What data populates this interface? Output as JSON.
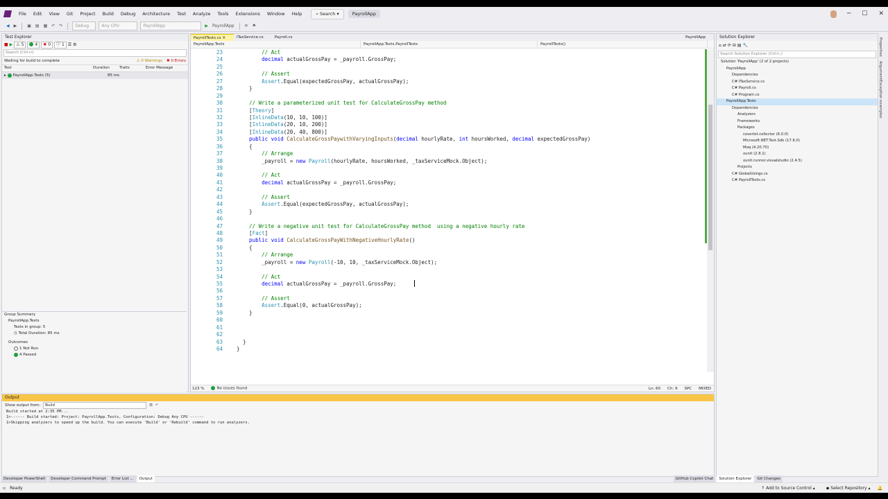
{
  "menubar": {
    "items": [
      "File",
      "Edit",
      "View",
      "Git",
      "Project",
      "Build",
      "Debug",
      "Architecture",
      "Test",
      "Analyze",
      "Tools",
      "Extensions",
      "Window",
      "Help"
    ],
    "search": "Search",
    "app_title": "PayrollApp"
  },
  "toolbar": {
    "config": "Debug",
    "platform": "Any CPU",
    "project": "PayrollApp",
    "run_target": "PayrollApp"
  },
  "test_explorer": {
    "title": "Test Explorer",
    "counts": {
      "warn": "5",
      "passed": "4",
      "failed": "0",
      "not_run": "1"
    },
    "search_placeholder": "Search (Ctrl+I)",
    "status": "Waiting for build to complete",
    "warnings": "0 Warnings",
    "errors": "0 Errors",
    "columns": {
      "test": "Test",
      "duration": "Duration",
      "traits": "Traits",
      "error": "Error Message"
    },
    "row": {
      "name": "PayrollApp.Tests (5)",
      "duration": "85 ms"
    },
    "summary": {
      "title": "Group Summary",
      "project": "PayrollApp.Tests",
      "tests_in_group": "Tests in group: 5",
      "total_duration": "Total Duration: 85 ms",
      "outcomes": "Outcomes",
      "not_run": "1 Not Run",
      "passed": "4 Passed"
    }
  },
  "editor": {
    "tabs": [
      "PayrollTests.cs",
      "ITaxService.cs",
      "Payroll.cs"
    ],
    "right_tab": "PayrollApp",
    "nav": [
      "PayrollApp.Tests",
      "PayrollApp.Tests.PayrollTests",
      "PayrollTests()"
    ],
    "status": {
      "zoom": "123 %",
      "issues": "No issues found",
      "ln": "Ln: 60",
      "ch": "Ch: 9",
      "spc": "SPC",
      "mixed": "MIXED"
    }
  },
  "code_lines": [
    {
      "n": "23",
      "t": [
        [
          "c",
          "        // Act"
        ]
      ]
    },
    {
      "n": "24",
      "t": [
        [
          "",
          "        "
        ],
        [
          "k",
          "decimal"
        ],
        [
          "",
          " actualGrossPay = _payroll.GrossPay;"
        ]
      ]
    },
    {
      "n": "25",
      "t": []
    },
    {
      "n": "26",
      "t": [
        [
          "c",
          "        // Assert"
        ]
      ]
    },
    {
      "n": "27",
      "t": [
        [
          "",
          "        "
        ],
        [
          "t",
          "Assert"
        ],
        [
          "",
          ".Equal(expectedGrossPay, actualGrossPay);"
        ]
      ]
    },
    {
      "n": "28",
      "t": [
        [
          "",
          "    }"
        ]
      ]
    },
    {
      "n": "29",
      "t": []
    },
    {
      "n": "30",
      "t": [
        [
          "c",
          "    // Write a parameterized unit test for CalculateGrossPay method"
        ]
      ]
    },
    {
      "n": "31",
      "t": [
        [
          "",
          "    ["
        ],
        [
          "t",
          "Theory"
        ],
        [
          "",
          "]"
        ]
      ]
    },
    {
      "n": "32",
      "t": [
        [
          "",
          "    ["
        ],
        [
          "t",
          "InlineData"
        ],
        [
          "",
          "(10, 10, 100)]"
        ]
      ]
    },
    {
      "n": "33",
      "t": [
        [
          "",
          "    ["
        ],
        [
          "t",
          "InlineData"
        ],
        [
          "",
          "(20, 10, 200)]"
        ]
      ]
    },
    {
      "n": "34",
      "t": [
        [
          "",
          "    ["
        ],
        [
          "t",
          "InlineData"
        ],
        [
          "",
          "(20, 40, 800)]"
        ]
      ]
    },
    {
      "n": "35",
      "t": [
        [
          "k",
          "    public void "
        ],
        [
          "m",
          "CalculateGrossPaywithVaryingInputs"
        ],
        [
          "",
          "("
        ],
        [
          "k",
          "decimal"
        ],
        [
          "",
          " hourlyRate, "
        ],
        [
          "k",
          "int"
        ],
        [
          "",
          " hoursWorked, "
        ],
        [
          "k",
          "decimal"
        ],
        [
          "",
          " expectedGrossPay)"
        ]
      ]
    },
    {
      "n": "36",
      "t": [
        [
          "",
          "    {"
        ]
      ]
    },
    {
      "n": "37",
      "t": [
        [
          "c",
          "        // Arrange"
        ]
      ]
    },
    {
      "n": "38",
      "t": [
        [
          "",
          "        _payroll = "
        ],
        [
          "k",
          "new "
        ],
        [
          "t",
          "Payroll"
        ],
        [
          "",
          "(hourlyRate, hoursWorked, _taxServiceMock.Object);"
        ]
      ]
    },
    {
      "n": "39",
      "t": []
    },
    {
      "n": "40",
      "t": [
        [
          "c",
          "        // Act"
        ]
      ]
    },
    {
      "n": "41",
      "t": [
        [
          "",
          "        "
        ],
        [
          "k",
          "decimal"
        ],
        [
          "",
          " actualGrossPay = _payroll.GrossPay;"
        ]
      ]
    },
    {
      "n": "42",
      "t": []
    },
    {
      "n": "43",
      "t": [
        [
          "c",
          "        // Assert"
        ]
      ]
    },
    {
      "n": "44",
      "t": [
        [
          "",
          "        "
        ],
        [
          "t",
          "Assert"
        ],
        [
          "",
          ".Equal(expectedGrossPay, actualGrossPay);"
        ]
      ]
    },
    {
      "n": "45",
      "t": [
        [
          "",
          "    }"
        ]
      ]
    },
    {
      "n": "46",
      "t": []
    },
    {
      "n": "47",
      "t": [
        [
          "c",
          "    // Write a negative unit test for CalculateGrossPay method  using a negative hourly rate"
        ]
      ]
    },
    {
      "n": "48",
      "t": [
        [
          "",
          "    ["
        ],
        [
          "t",
          "Fact"
        ],
        [
          "",
          "]"
        ]
      ]
    },
    {
      "n": "49",
      "t": [
        [
          "k",
          "    public void "
        ],
        [
          "m",
          "CalculateGrossPayWithNegativeHourlyRate"
        ],
        [
          "",
          "()"
        ]
      ]
    },
    {
      "n": "50",
      "t": [
        [
          "",
          "    {"
        ]
      ]
    },
    {
      "n": "51",
      "t": [
        [
          "c",
          "        // Arrange"
        ]
      ]
    },
    {
      "n": "52",
      "t": [
        [
          "",
          "        _payroll = "
        ],
        [
          "k",
          "new "
        ],
        [
          "t",
          "Payroll"
        ],
        [
          "",
          "(-10, 10, _taxServiceMock.Object);"
        ]
      ]
    },
    {
      "n": "53",
      "t": []
    },
    {
      "n": "54",
      "t": [
        [
          "c",
          "        // Act"
        ]
      ]
    },
    {
      "n": "55",
      "t": [
        [
          "",
          "        "
        ],
        [
          "k",
          "decimal"
        ],
        [
          "",
          " actualGrossPay = _payroll.GrossPay;"
        ]
      ]
    },
    {
      "n": "56",
      "t": []
    },
    {
      "n": "57",
      "t": [
        [
          "c",
          "        // Assert"
        ]
      ]
    },
    {
      "n": "58",
      "t": [
        [
          "",
          "        "
        ],
        [
          "t",
          "Assert"
        ],
        [
          "",
          ".Equal(0, actualGrossPay);"
        ]
      ]
    },
    {
      "n": "59",
      "t": [
        [
          "",
          "    }"
        ]
      ]
    },
    {
      "n": "60",
      "t": []
    },
    {
      "n": "61",
      "t": []
    },
    {
      "n": "62",
      "t": []
    },
    {
      "n": "63",
      "t": [
        [
          "",
          "  }"
        ]
      ]
    },
    {
      "n": "64",
      "t": [
        [
          "",
          "}"
        ]
      ]
    }
  ],
  "output": {
    "title": "Output",
    "show_from_label": "Show output from:",
    "source": "Build",
    "lines": [
      "Build started at 2:35 PM...",
      "1>------ Build started: Project: PayrollApp.Tests, Configuration: Debug Any CPU ------",
      "1>Skipping analyzers to speed up the build. You can execute 'Build' or 'Rebuild' command to run analyzers."
    ]
  },
  "solution_explorer": {
    "title": "Solution Explorer",
    "search_placeholder": "Search Solution Explorer (Ctrl+;)",
    "tree": [
      {
        "indent": 0,
        "label": "Solution 'PayrollApp' (2 of 2 projects)"
      },
      {
        "indent": 1,
        "label": "PayrollApp"
      },
      {
        "indent": 2,
        "label": "Dependencies"
      },
      {
        "indent": 2,
        "label": "C# ITaxService.cs"
      },
      {
        "indent": 2,
        "label": "C# Payroll.cs"
      },
      {
        "indent": 2,
        "label": "C# Program.cs"
      },
      {
        "indent": 1,
        "label": "PayrollApp.Tests",
        "sel": true
      },
      {
        "indent": 2,
        "label": "Dependencies"
      },
      {
        "indent": 3,
        "label": "Analyzers"
      },
      {
        "indent": 3,
        "label": "Frameworks"
      },
      {
        "indent": 3,
        "label": "Packages"
      },
      {
        "indent": 4,
        "label": "coverlet.collector (6.0.0)"
      },
      {
        "indent": 4,
        "label": "Microsoft.NET.Test.Sdk (17.6.0)"
      },
      {
        "indent": 4,
        "label": "Moq (4.20.70)"
      },
      {
        "indent": 4,
        "label": "xunit (2.8.1)"
      },
      {
        "indent": 4,
        "label": "xunit.runner.visualstudio (2.4.5)"
      },
      {
        "indent": 3,
        "label": "Projects"
      },
      {
        "indent": 2,
        "label": "C# GlobalUsings.cs"
      },
      {
        "indent": 2,
        "label": "C# PayrollTests.cs"
      }
    ]
  },
  "side_strip": [
    "Properties",
    "ArgumentException examples"
  ],
  "bottom_tabs": [
    "Developer PowerShell",
    "Developer Command Prompt",
    "Error List ...",
    "Output"
  ],
  "right_bottom_tabs": [
    "GitHub Copilot Chat",
    "Solution Explorer",
    "Git Changes"
  ],
  "statusbar": {
    "ready": "Ready",
    "source_control": "Add to Source Control",
    "repo": "Select Repository"
  }
}
